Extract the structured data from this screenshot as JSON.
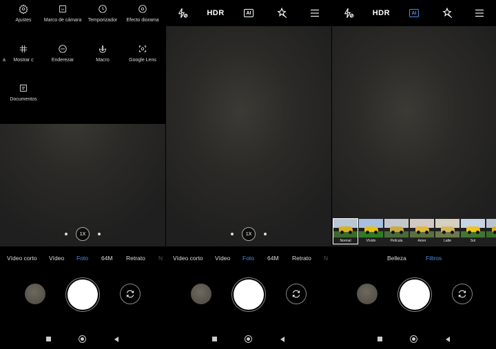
{
  "panel1": {
    "settings_menu": [
      {
        "label": "Ajustes",
        "icon": "gear-icon"
      },
      {
        "label": "Marco de cámara",
        "icon": "aspect-ratio-icon"
      },
      {
        "label": "Temporizador",
        "icon": "timer-icon"
      },
      {
        "label": "Efecto diorama",
        "icon": "tilt-shift-icon"
      },
      {
        "label": "a",
        "icon": ""
      },
      {
        "label": "Mostrar c",
        "icon": "grid-icon"
      },
      {
        "label": "Enderezar",
        "icon": "straighten-icon"
      },
      {
        "label": "Macro",
        "icon": "macro-icon"
      },
      {
        "label": "Google Lens",
        "icon": "google-lens-icon"
      },
      {
        "label": "Documentos",
        "icon": "document-icon"
      }
    ],
    "zoom": "1X",
    "modes": [
      "Vídeo corto",
      "Vídeo",
      "Foto",
      "64M",
      "Retrato",
      "N"
    ]
  },
  "panel2": {
    "topbar": {
      "hdr": "HDR",
      "ai": "AI"
    },
    "zoom": "1X",
    "modes": [
      "Vídeo corto",
      "Vídeo",
      "Foto",
      "64M",
      "Retrato",
      "N"
    ]
  },
  "panel3": {
    "topbar": {
      "hdr": "HDR",
      "ai": "AI"
    },
    "filters": [
      "Normal",
      "Vívido",
      "Película",
      "Amor",
      "Latte",
      "Sol",
      "C"
    ],
    "tabs": [
      "Belleza",
      "Filtros"
    ]
  },
  "colors": {
    "accent": "#4a90e2",
    "background": "#000000"
  }
}
